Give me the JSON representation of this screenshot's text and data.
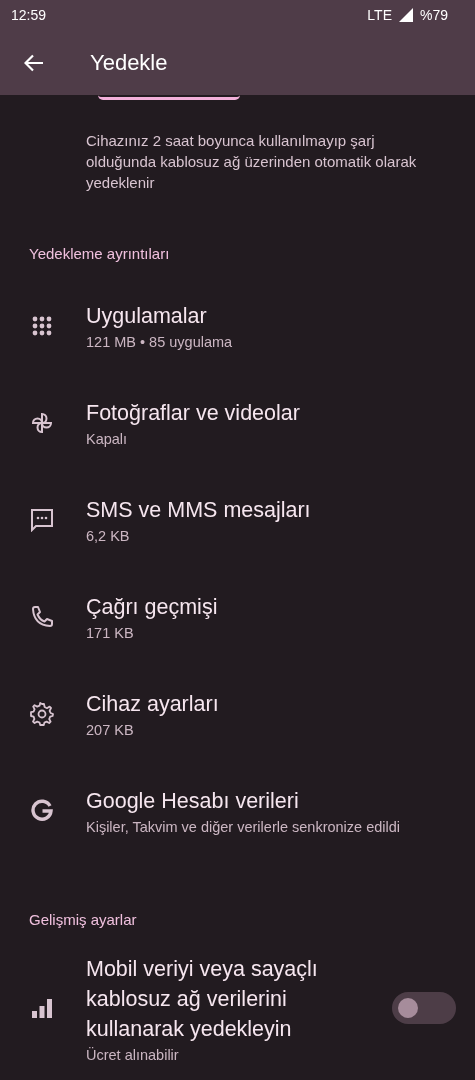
{
  "status_bar": {
    "time": "12:59",
    "network": "LTE",
    "battery": "%79"
  },
  "app_bar": {
    "title": "Yedekle"
  },
  "description": "Cihazınız 2 saat boyunca kullanılmayıp şarj olduğunda kablosuz ağ üzerinden otomatik olarak yedeklenir",
  "sections": [
    {
      "header": "Yedekleme ayrıntıları",
      "items": [
        {
          "title": "Uygulamalar",
          "subtitle": "121 MB • 85 uygulama"
        },
        {
          "title": "Fotoğraflar ve videolar",
          "subtitle": "Kapalı"
        },
        {
          "title": "SMS ve MMS mesajları",
          "subtitle": "6,2 KB"
        },
        {
          "title": "Çağrı geçmişi",
          "subtitle": "171 KB"
        },
        {
          "title": "Cihaz ayarları",
          "subtitle": "207 KB"
        },
        {
          "title": "Google Hesabı verileri",
          "subtitle": "Kişiler, Takvim ve diğer verilerle senkronize edildi"
        }
      ]
    },
    {
      "header": "Gelişmiş ayarlar",
      "items": [
        {
          "title": "Mobil veriyi veya sayaçlı kablosuz ağ verilerini kullanarak yedekleyin",
          "subtitle": "Ücret alınabilir",
          "toggle": {
            "on": false
          }
        }
      ]
    }
  ]
}
